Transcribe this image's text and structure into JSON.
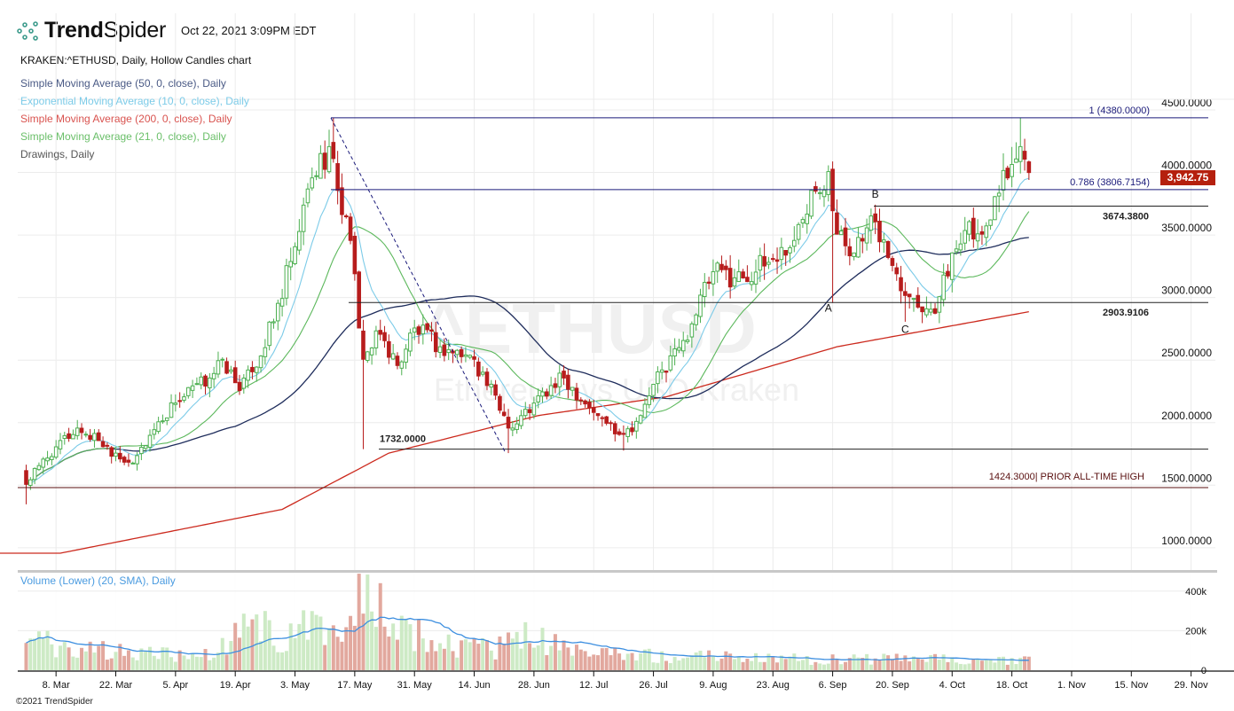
{
  "header": {
    "brand_bold": "Trend",
    "brand_light": "Spider",
    "timestamp": "Oct 22, 2021 3:09PM EDT",
    "symbol_line": "KRAKEN:^ETHUSD, Daily, Hollow Candles chart",
    "legend": [
      {
        "label": "Simple Moving Average (50, 0, close), Daily",
        "color": "#4a5a85"
      },
      {
        "label": "Exponential Moving Average (10, 0, close), Daily",
        "color": "#7ccbe8"
      },
      {
        "label": "Simple Moving Average (200, 0, close), Daily",
        "color": "#d9534f"
      },
      {
        "label": "Simple Moving Average (21, 0, close), Daily",
        "color": "#6abf69"
      },
      {
        "label": "Drawings, Daily",
        "color": "#555555"
      }
    ]
  },
  "watermark": {
    "symbol": "^ETHUSD",
    "name": "Ethereum vs USD Kraken"
  },
  "current_price": "3,942.75",
  "volume_title": "Volume (Lower) (20, SMA), Daily",
  "copyright": "©2021 TrendSpider",
  "colors": {
    "up": "#4caf50",
    "down": "#b71c1c",
    "vol_up": "#cdeac5",
    "vol_down": "#e2a89e",
    "vol_sma": "#3d8fe0",
    "sma50": "#1f2d5c",
    "ema10": "#7ccbe8",
    "sma200": "#cc2a1e",
    "sma21": "#5cb85c",
    "fib": "#1a1a7a",
    "level": "#222222",
    "ath": "#5a1010"
  },
  "chart_data": {
    "type": "candlestick",
    "title": "KRAKEN:^ETHUSD, Daily, Hollow Candles chart",
    "y_ticks": [
      "4500.0000",
      "4000.0000",
      "3500.0000",
      "3000.0000",
      "2500.0000",
      "2000.0000",
      "1500.0000",
      "1000.0000"
    ],
    "y_tick_values": [
      4500,
      4000,
      3500,
      3000,
      2500,
      2000,
      1500,
      1000
    ],
    "ylim": [
      650,
      4900
    ],
    "x_ticks": [
      "8. Mar",
      "22. Mar",
      "5. Apr",
      "19. Apr",
      "3. May",
      "17. May",
      "31. May",
      "14. Jun",
      "28. Jun",
      "12. Jul",
      "26. Jul",
      "9. Aug",
      "23. Aug",
      "6. Sep",
      "20. Sep",
      "4. Oct",
      "18. Oct",
      "1. Nov",
      "15. Nov",
      "29. Nov"
    ],
    "x_tick_days": [
      7,
      21,
      35,
      49,
      63,
      77,
      91,
      105,
      119,
      133,
      147,
      161,
      175,
      189,
      203,
      217,
      231,
      245,
      259,
      273
    ],
    "x_start": "2021-03-01",
    "close_anchors_day_price": [
      [
        0,
        1450
      ],
      [
        3,
        1600
      ],
      [
        7,
        1750
      ],
      [
        12,
        1900
      ],
      [
        17,
        1800
      ],
      [
        21,
        1700
      ],
      [
        25,
        1620
      ],
      [
        31,
        1950
      ],
      [
        35,
        2100
      ],
      [
        43,
        2300
      ],
      [
        46,
        2450
      ],
      [
        50,
        2200
      ],
      [
        53,
        2350
      ],
      [
        58,
        2750
      ],
      [
        63,
        3350
      ],
      [
        67,
        3900
      ],
      [
        71,
        4150
      ],
      [
        73,
        3800
      ],
      [
        76,
        3400
      ],
      [
        78,
        2700
      ],
      [
        79,
        2450
      ],
      [
        83,
        2650
      ],
      [
        87,
        2400
      ],
      [
        91,
        2700
      ],
      [
        97,
        2550
      ],
      [
        105,
        2450
      ],
      [
        112,
        2000
      ],
      [
        114,
        1900
      ],
      [
        119,
        2100
      ],
      [
        126,
        2300
      ],
      [
        134,
        2000
      ],
      [
        140,
        1850
      ],
      [
        144,
        2000
      ],
      [
        147,
        2250
      ],
      [
        154,
        2600
      ],
      [
        161,
        3150
      ],
      [
        168,
        3100
      ],
      [
        175,
        3250
      ],
      [
        180,
        3400
      ],
      [
        184,
        3800
      ],
      [
        188,
        3950
      ],
      [
        190,
        3450
      ],
      [
        194,
        3300
      ],
      [
        199,
        3550
      ],
      [
        203,
        3200
      ],
      [
        207,
        2950
      ],
      [
        212,
        2850
      ],
      [
        214,
        2950
      ],
      [
        217,
        3300
      ],
      [
        221,
        3550
      ],
      [
        224,
        3450
      ],
      [
        227,
        3750
      ],
      [
        230,
        3900
      ],
      [
        233,
        4150
      ],
      [
        234,
        4050
      ],
      [
        235,
        3942.75
      ]
    ],
    "wick_extremes_day_price": [
      [
        0,
        1290
      ],
      [
        72,
        4380
      ],
      [
        79,
        1732
      ],
      [
        113,
        1700
      ],
      [
        140,
        1720
      ],
      [
        189,
        2900
      ],
      [
        206,
        2750
      ],
      [
        233,
        4380
      ]
    ],
    "sma200_anchors_day_price": [
      [
        8,
        900
      ],
      [
        60,
        1250
      ],
      [
        85,
        1700
      ],
      [
        120,
        2000
      ],
      [
        150,
        2150
      ],
      [
        190,
        2550
      ],
      [
        235,
        2830
      ]
    ],
    "volume_anchors_day_k": [
      [
        0,
        150
      ],
      [
        20,
        90
      ],
      [
        40,
        70
      ],
      [
        48,
        120
      ],
      [
        53,
        270
      ],
      [
        60,
        120
      ],
      [
        65,
        200
      ],
      [
        75,
        170
      ],
      [
        78,
        450
      ],
      [
        82,
        350
      ],
      [
        86,
        250
      ],
      [
        95,
        130
      ],
      [
        110,
        100
      ],
      [
        118,
        160
      ],
      [
        130,
        80
      ],
      [
        150,
        70
      ],
      [
        170,
        60
      ],
      [
        190,
        50
      ],
      [
        205,
        60
      ],
      [
        220,
        45
      ],
      [
        235,
        55
      ]
    ],
    "volume_ticks": [
      "400k",
      "200k",
      "0"
    ],
    "volume_tick_values": [
      400000,
      200000,
      0
    ],
    "annotations": [
      {
        "text": "1 (4380.0000)",
        "price": 4380,
        "kind": "fib"
      },
      {
        "text": "0.786 (3806.7154)",
        "price": 3806.7154,
        "kind": "fib"
      },
      {
        "text": "3674.3800",
        "price": 3674.38,
        "kind": "level"
      },
      {
        "text": "2903.9106",
        "price": 2903.9106,
        "kind": "level"
      },
      {
        "text": "1732.0000",
        "price": 1732,
        "kind": "level"
      },
      {
        "text": "1424.3000| PRIOR ALL-TIME HIGH",
        "price": 1424.3,
        "kind": "ath"
      }
    ],
    "points": [
      {
        "text": "A",
        "day": 188,
        "price": 2830
      },
      {
        "text": "B",
        "day": 199,
        "price": 3740
      },
      {
        "text": "C",
        "day": 206,
        "price": 2660
      }
    ]
  }
}
